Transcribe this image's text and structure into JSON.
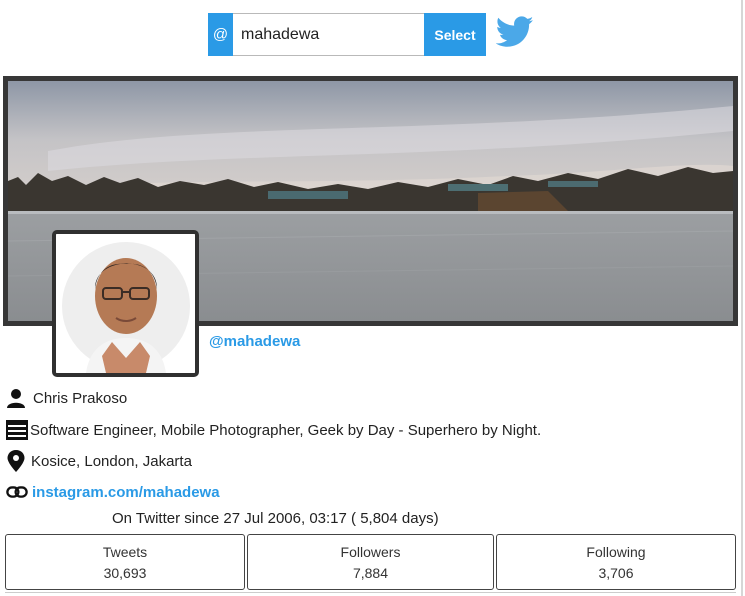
{
  "search": {
    "prefix": "@",
    "value": "mahadewa",
    "button_label": "Select"
  },
  "profile": {
    "handle": "@mahadewa",
    "name": "Chris Prakoso",
    "bio": "Software Engineer, Mobile Photographer, Geek by Day - Superhero by Night.",
    "location": "Kosice, London, Jakarta",
    "website": "instagram.com/mahadewa",
    "since": "On Twitter since 27 Jul 2006, 03:17 ( 5,804 days)"
  },
  "stats": {
    "tweets_label": "Tweets",
    "tweets_value": "30,693",
    "followers_label": "Followers",
    "followers_value": "7,884",
    "following_label": "Following",
    "following_value": "3,706"
  },
  "icons": {
    "twitter": "twitter-bird-icon",
    "name": "person-icon",
    "bio": "list-icon",
    "location": "map-pin-icon",
    "website": "link-icon"
  },
  "colors": {
    "accent": "#2a9ae6",
    "twitter_blue": "#4ba8e8",
    "frame": "#373737"
  }
}
